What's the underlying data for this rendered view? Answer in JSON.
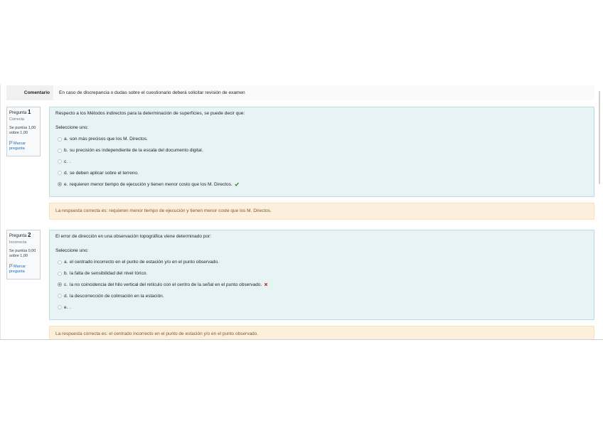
{
  "comment": {
    "label": "Comentario",
    "text": "En caso de discrepancia o dudas sobre el cuestionario deberá solicitar revisión de examen"
  },
  "questions": [
    {
      "title": "Pregunta",
      "number": "1",
      "state": "Correcta",
      "grade": "Se puntúa 1,00 sobre 1,00",
      "flag_label": "Marcar pregunta",
      "prompt": "Respecto a los Métodos indirectos para la determinación de superficies, se puede decir que:",
      "select_label": "Seleccione uno:",
      "options": [
        {
          "letter": "a.",
          "text": "son más precisos que los M. Directos.",
          "selected": false
        },
        {
          "letter": "b.",
          "text": "su precisión es independiente de la escala del documento digital.",
          "selected": false
        },
        {
          "letter": "c.",
          "text": ".",
          "selected": false
        },
        {
          "letter": "d.",
          "text": "se deben aplicar sobre el terreno.",
          "selected": false
        },
        {
          "letter": "e.",
          "text": "requieren menor tiempo de ejecución y tienen menor costo que los M. Directos.",
          "selected": true,
          "mark": "check-icon"
        }
      ],
      "feedback": "La respuesta correcta es: requieren menor tiempo de ejecución y tienen menor coste que los M. Directos."
    },
    {
      "title": "Pregunta",
      "number": "2",
      "state": "Incorrecta",
      "grade": "Se puntúa 0,00 sobre 1,00",
      "flag_label": "Marcar pregunta",
      "prompt": "El error de dirección en una observación topográfica viene determinado por:",
      "select_label": "Seleccione uno:",
      "options": [
        {
          "letter": "a.",
          "text": "el centrado incorrecto en el punto de estación y/o en el punto observado.",
          "selected": false
        },
        {
          "letter": "b.",
          "text": "la falta de sensibilidad del nivel tórico.",
          "selected": false
        },
        {
          "letter": "c.",
          "text": "la no coincidencia del hilo vertical del retículo con el centro de la señal en el punto observado.",
          "selected": true,
          "mark": "cross-icon"
        },
        {
          "letter": "d.",
          "text": "la descorrección de colimación en la estación.",
          "selected": false
        },
        {
          "letter": "e.",
          "text": ".",
          "selected": false
        }
      ],
      "feedback": "La respuesta correcta es: el centrado incorrecto en el punto de estación y/o en el punto observado."
    }
  ],
  "icons": {
    "flag": "flag-icon",
    "correct": "check-icon",
    "incorrect": "cross-icon"
  },
  "colors": {
    "link": "#0f6cbf",
    "correct": "#357a32",
    "incorrect": "#ca3120",
    "question_bg": "#e7f3f5",
    "feedback_bg": "#fcefdc",
    "feedback_text": "#7d5a29"
  }
}
